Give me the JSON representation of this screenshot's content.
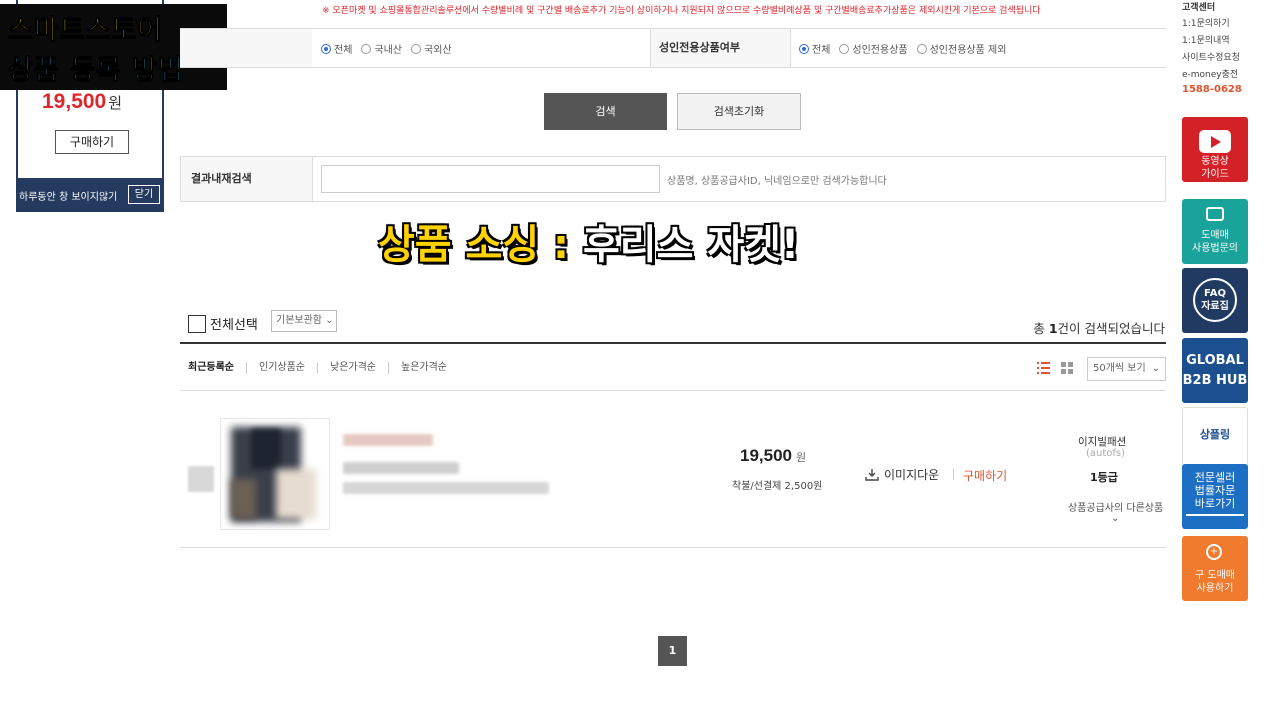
{
  "popup": {
    "price": "19,500",
    "price_unit": "원",
    "buy_label": "구매하기",
    "hide_today": "하루동안 창 보이지않기",
    "close_label": "닫기"
  },
  "overlay": {
    "title_line1": "스마트스토어",
    "title_line2": "상품 등록 방법",
    "caption_highlight": "상품 소싱 :",
    "caption_rest": " 후리스 자켓!"
  },
  "filters": {
    "notice": "※ 오픈마켓 및 쇼핑몰통합관리솔루션에서 수량별비례 및 구간별 배송료추가 기능이 상이하거나 지원되지 않으므로 수량별비례상품 및 구간별배송료추가상품은 제외시킨게 기본으로 검색됩니다",
    "origin_options": [
      "전체",
      "국내산",
      "국외산"
    ],
    "adult_label": "성인전용상품여부",
    "adult_options": [
      "전체",
      "성인전용상품",
      "성인전용상품 제외"
    ],
    "search_button": "검색",
    "reset_button": "검색초기화",
    "result_label": "결과내재검색",
    "result_placeholder": "",
    "result_help": "상품명, 상품공급사ID, 닉네임으로만 검색가능합니다"
  },
  "toolbar": {
    "select_all": "전체선택",
    "storage_select": "기본보관함",
    "total_prefix": "총 ",
    "total_count": "1",
    "total_suffix": "건이 검색되었습니다",
    "sort_tabs": [
      "최근등록순",
      "인기상품순",
      "낮은가격순",
      "높은가격순"
    ],
    "per_page": "50개씩 보기"
  },
  "product": {
    "price": "19,500",
    "price_unit": "원",
    "shipping": "착불/선결제 2,500원",
    "image_download": "이미지다운",
    "buy_label": "구매하기",
    "seller_name": "이지빌패션",
    "seller_id": "(autofs)",
    "seller_grade": "1등급",
    "other_products": "상품공급사의 다른상품"
  },
  "pagination": {
    "current": "1"
  },
  "sidebar": {
    "cs_title": "고객센터",
    "cs_links": [
      "1:1문의하기",
      "1:1문의내역",
      "사이트수정요청",
      "e-money충전"
    ],
    "cs_phone": "1588-0628",
    "buttons": [
      {
        "line1": "동영상",
        "line2": "가이드",
        "color": "#d32127",
        "icon": "play-icon"
      },
      {
        "line1": "도매매",
        "line2": "사용법문의",
        "color": "#1aa39a",
        "icon": "chat-icon"
      },
      {
        "line1": "FAQ",
        "line2": "자료집",
        "color": "#213a62",
        "icon": "faq-icon"
      },
      {
        "line1": "GLOBAL",
        "line2": "B2B HUB",
        "color": "#1b4f8f",
        "icon": "globe-icon"
      },
      {
        "line1": "상플링",
        "line2": "",
        "color": "#ffffff",
        "icon": "logo-icon"
      },
      {
        "line1": "전문셀러",
        "line2": "법률자문",
        "line3": "바로가기",
        "color": "#1c6fc2",
        "icon": "book-icon"
      },
      {
        "line1": "구 도매매",
        "line2": "사용하기",
        "color": "#f07a2e",
        "icon": "zoom-icon"
      }
    ]
  },
  "colors": {
    "accent_red": "#e0262d",
    "radio_blue": "#2d6be0",
    "caption_yellow": "#ffd200",
    "title_cyan": "#21d3f7"
  }
}
